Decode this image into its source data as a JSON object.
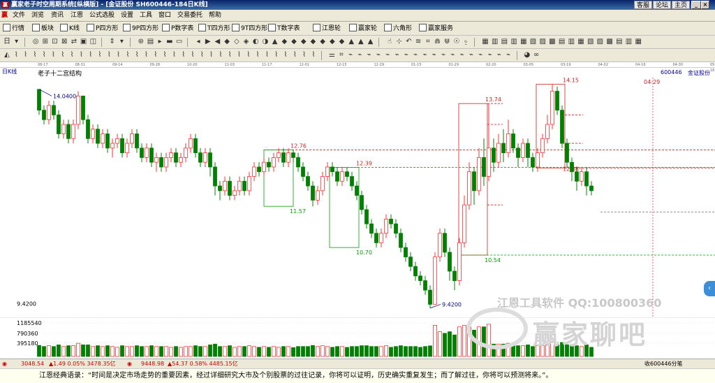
{
  "titlebar": {
    "title": "赢家老子时空周期系统[纵横版] - [金证股份  SH600446-184日K线]",
    "links": [
      "客服",
      "论坛",
      "主页"
    ]
  },
  "menu": [
    "文件",
    "浏览",
    "资讯",
    "江恩",
    "公式选股",
    "设置",
    "工具",
    "窗口",
    "交易委托",
    "帮助"
  ],
  "toolbar1": [
    {
      "icon": "grid",
      "label": "行情"
    },
    {
      "icon": "grid",
      "label": "板块"
    },
    {
      "icon": "K",
      "label": "K线"
    },
    {
      "icon": "P",
      "label": "P四方形"
    },
    {
      "icon": "9P",
      "label": "9P四方形"
    },
    {
      "icon": "P",
      "label": "P数字表"
    },
    {
      "icon": "T",
      "label": "T四方形"
    },
    {
      "icon": "9T",
      "label": "9T四方形"
    },
    {
      "icon": "TN",
      "label": "T数字表"
    },
    {
      "icon": "wheel",
      "label": "江恩轮"
    },
    {
      "icon": "wheel",
      "label": "赢家轮"
    },
    {
      "icon": "hex",
      "label": "六角形"
    },
    {
      "icon": "svc",
      "label": "赢家服务"
    }
  ],
  "datebar": [
    "08-17",
    "08-31",
    "09-14",
    "09-28",
    "10-20",
    "11-03",
    "11-17",
    "12-01",
    "12-15",
    "12-29",
    "01-15",
    "01-29",
    "02-20",
    "03-05",
    "03-19",
    "04-02",
    "04-16",
    "04-30",
    "05-16"
  ],
  "chart": {
    "period_label": "日K线",
    "stock_code": "600446",
    "stock_name": "金证股份",
    "structure_label": "老子十二宫结构",
    "high_label": "14.0400",
    "low_label": "9.4200",
    "axis_low": "9.4200",
    "forecast_date": "04-29",
    "levels": [
      {
        "value": "12.76"
      },
      {
        "value": "12.39"
      },
      {
        "value": "11.57"
      },
      {
        "value": "10.70"
      },
      {
        "value": "13.74"
      },
      {
        "value": "10.54"
      },
      {
        "value": "14.15"
      },
      {
        "value": "12.38"
      }
    ]
  },
  "volume": {
    "axis_labels": [
      "1185540",
      "790360",
      "395180"
    ]
  },
  "statusbar": {
    "index1": "3048.54",
    "index1_change": "▲1.49 0.05% 3478.35亿",
    "index2": "9448.98",
    "index2_change": "▲54.37 0.58% 4485.15亿",
    "right_text": "收600446分笔"
  },
  "quote": "江恩经典语录：“时间是决定市场走势的重要因素，经过详细研究大市及个别股票的过往记录，你将可以证明，历史确实重复发生；而了解过往，你将可以预测将来。”。",
  "watermark": {
    "line1": "江恩工具软件  QQ:100800360",
    "line2": "赢家聊吧"
  },
  "colors": {
    "up": "#ff3030",
    "down": "#008000",
    "level_red": "#d02020",
    "level_green": "#00a000"
  },
  "chart_data": {
    "type": "candlestick",
    "title": "600446 金证股份 日K线",
    "x_start": "08-17",
    "x_end": "04-02",
    "price_range": [
      9.42,
      14.15
    ],
    "highs_lows": {
      "high": 14.04,
      "low": 9.42
    },
    "candles": [
      [
        14.04,
        13.6,
        14.04,
        13.5
      ],
      [
        13.6,
        13.4,
        13.7,
        13.3
      ],
      [
        13.4,
        13.7,
        13.8,
        13.3
      ],
      [
        13.7,
        13.5,
        13.8,
        13.4
      ],
      [
        13.5,
        13.1,
        13.6,
        13.0
      ],
      [
        13.1,
        13.3,
        13.4,
        13.0
      ],
      [
        13.3,
        13.0,
        13.4,
        12.9
      ],
      [
        13.0,
        13.3,
        13.4,
        12.9
      ],
      [
        13.3,
        13.9,
        14.0,
        13.2
      ],
      [
        13.9,
        13.4,
        13.9,
        13.3
      ],
      [
        13.4,
        13.0,
        13.5,
        12.9
      ],
      [
        13.0,
        13.2,
        13.3,
        12.9
      ],
      [
        13.2,
        12.9,
        13.3,
        12.8
      ],
      [
        12.9,
        13.1,
        13.2,
        12.8
      ],
      [
        13.1,
        12.8,
        13.2,
        12.7
      ],
      [
        12.8,
        12.9,
        13.0,
        12.6
      ],
      [
        12.9,
        13.0,
        13.1,
        12.8
      ],
      [
        13.0,
        12.7,
        13.1,
        12.6
      ],
      [
        12.7,
        12.9,
        13.0,
        12.6
      ],
      [
        12.9,
        13.1,
        13.2,
        12.8
      ],
      [
        13.1,
        12.8,
        13.2,
        12.7
      ],
      [
        12.8,
        12.6,
        12.9,
        12.5
      ],
      [
        12.6,
        12.8,
        12.9,
        12.5
      ],
      [
        12.8,
        12.5,
        12.9,
        12.4
      ],
      [
        12.5,
        12.6,
        12.7,
        12.3
      ],
      [
        12.6,
        12.4,
        12.7,
        12.3
      ],
      [
        12.4,
        12.6,
        12.7,
        12.3
      ],
      [
        12.6,
        12.7,
        12.8,
        12.5
      ],
      [
        12.7,
        12.5,
        12.8,
        12.4
      ],
      [
        12.5,
        12.6,
        12.7,
        12.4
      ],
      [
        12.6,
        12.8,
        12.9,
        12.5
      ],
      [
        12.8,
        13.0,
        13.1,
        12.7
      ],
      [
        13.0,
        12.7,
        13.1,
        12.6
      ],
      [
        12.7,
        12.5,
        12.8,
        12.4
      ],
      [
        12.5,
        12.7,
        12.8,
        12.4
      ],
      [
        12.7,
        12.4,
        12.8,
        12.2
      ],
      [
        12.4,
        12.0,
        12.5,
        11.8
      ],
      [
        12.0,
        11.9,
        12.1,
        11.7
      ],
      [
        11.9,
        12.1,
        12.2,
        11.8
      ],
      [
        12.1,
        11.8,
        12.2,
        11.7
      ],
      [
        11.8,
        11.9,
        12.0,
        11.7
      ],
      [
        11.9,
        12.1,
        12.2,
        11.8
      ],
      [
        12.1,
        11.9,
        12.2,
        11.8
      ],
      [
        11.9,
        12.2,
        12.3,
        11.8
      ],
      [
        12.2,
        12.4,
        12.5,
        12.1
      ],
      [
        12.4,
        12.3,
        12.5,
        12.2
      ],
      [
        12.3,
        12.5,
        12.6,
        12.2
      ],
      [
        12.5,
        12.4,
        12.6,
        12.3
      ],
      [
        12.4,
        12.6,
        12.7,
        12.3
      ],
      [
        12.6,
        12.7,
        12.8,
        12.5
      ],
      [
        12.7,
        12.5,
        12.8,
        12.4
      ],
      [
        12.5,
        12.7,
        12.8,
        12.4
      ],
      [
        12.7,
        12.6,
        12.76,
        12.5
      ],
      [
        12.6,
        12.4,
        12.7,
        12.3
      ],
      [
        12.4,
        12.2,
        12.5,
        12.1
      ],
      [
        12.2,
        12.0,
        12.3,
        11.9
      ],
      [
        12.0,
        11.7,
        12.1,
        11.57
      ],
      [
        11.7,
        11.9,
        12.0,
        11.6
      ],
      [
        11.9,
        12.2,
        12.3,
        11.8
      ],
      [
        12.2,
        12.4,
        12.5,
        12.1
      ],
      [
        12.4,
        12.3,
        12.5,
        12.2
      ],
      [
        12.3,
        12.1,
        12.4,
        12.0
      ],
      [
        12.1,
        12.3,
        12.4,
        12.0
      ],
      [
        12.3,
        12.2,
        12.39,
        12.1
      ],
      [
        12.2,
        12.0,
        12.3,
        11.9
      ],
      [
        12.0,
        11.8,
        12.1,
        11.7
      ],
      [
        11.8,
        11.5,
        11.9,
        11.4
      ],
      [
        11.5,
        11.2,
        11.6,
        11.1
      ],
      [
        11.2,
        11.0,
        11.3,
        10.9
      ],
      [
        11.0,
        10.8,
        11.1,
        10.7
      ],
      [
        10.8,
        11.0,
        11.1,
        10.7
      ],
      [
        11.0,
        11.3,
        11.4,
        10.9
      ],
      [
        11.3,
        11.2,
        11.4,
        11.1
      ],
      [
        11.2,
        11.0,
        11.3,
        10.9
      ],
      [
        11.0,
        10.7,
        11.1,
        10.6
      ],
      [
        10.7,
        10.5,
        10.8,
        10.4
      ],
      [
        10.5,
        10.3,
        10.6,
        10.2
      ],
      [
        10.3,
        10.1,
        10.4,
        10.0
      ],
      [
        10.1,
        10.0,
        10.2,
        9.9
      ],
      [
        10.0,
        9.8,
        10.1,
        9.7
      ],
      [
        9.8,
        9.5,
        9.9,
        9.42
      ],
      [
        9.5,
        10.5,
        10.6,
        9.5
      ],
      [
        10.5,
        11.0,
        11.1,
        10.4
      ],
      [
        11.0,
        10.6,
        11.1,
        10.5
      ],
      [
        10.6,
        10.2,
        10.7,
        10.0
      ],
      [
        10.2,
        10.0,
        10.3,
        9.8
      ],
      [
        10.0,
        10.8,
        10.9,
        9.9
      ],
      [
        10.8,
        11.6,
        11.8,
        10.7
      ],
      [
        11.6,
        12.3,
        12.5,
        11.5
      ],
      [
        12.3,
        11.9,
        12.4,
        11.6
      ],
      [
        11.9,
        12.6,
        12.8,
        11.8
      ],
      [
        12.6,
        12.2,
        13.0,
        12.0
      ],
      [
        12.2,
        12.8,
        13.74,
        12.1
      ],
      [
        12.8,
        12.5,
        13.0,
        12.3
      ],
      [
        12.5,
        12.9,
        13.1,
        12.4
      ],
      [
        12.9,
        12.7,
        13.2,
        12.5
      ],
      [
        12.7,
        13.1,
        13.4,
        12.6
      ],
      [
        13.1,
        12.8,
        13.2,
        12.7
      ],
      [
        12.8,
        12.6,
        12.9,
        12.4
      ],
      [
        12.6,
        12.9,
        13.0,
        12.5
      ],
      [
        12.9,
        12.6,
        13.0,
        12.4
      ],
      [
        12.6,
        12.4,
        12.7,
        12.3
      ],
      [
        12.4,
        12.7,
        12.8,
        12.3
      ],
      [
        12.7,
        13.0,
        13.1,
        12.6
      ],
      [
        13.0,
        13.3,
        13.5,
        12.9
      ],
      [
        13.3,
        14.0,
        14.15,
        13.2
      ],
      [
        14.0,
        13.6,
        14.1,
        13.5
      ],
      [
        13.6,
        12.9,
        13.7,
        12.8
      ],
      [
        12.9,
        12.5,
        13.0,
        12.38
      ],
      [
        12.5,
        12.3,
        12.6,
        12.1
      ],
      [
        12.3,
        12.1,
        12.4,
        11.9
      ],
      [
        12.1,
        12.3,
        12.4,
        12.0
      ],
      [
        12.3,
        12.0,
        12.4,
        11.8
      ],
      [
        12.0,
        11.9,
        12.1,
        11.8
      ]
    ],
    "volume_axis": [
      395180,
      790360,
      1185540
    ]
  }
}
